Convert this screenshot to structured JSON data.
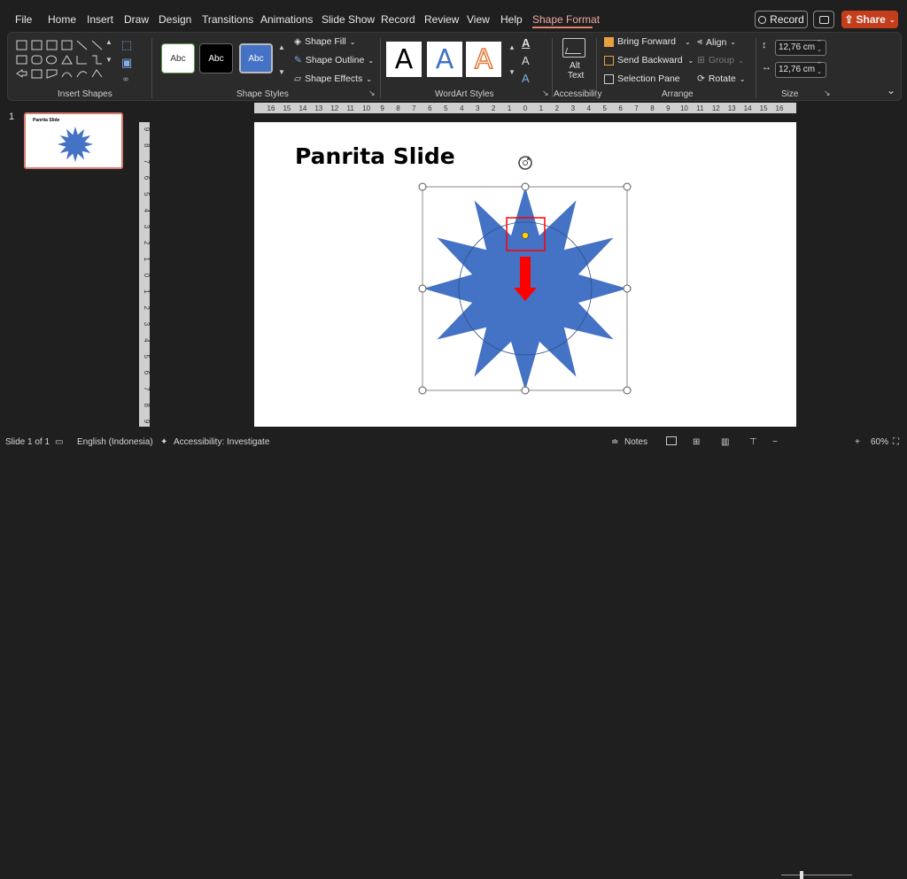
{
  "menu": {
    "tabs": [
      "File",
      "Home",
      "Insert",
      "Draw",
      "Design",
      "Transitions",
      "Animations",
      "Slide Show",
      "Record",
      "Review",
      "View",
      "Help",
      "Shape Format"
    ],
    "active_tab": "Shape Format",
    "record_label": "Record",
    "share_label": "Share"
  },
  "ribbon": {
    "insert_shapes_label": "Insert Shapes",
    "shape_styles": {
      "label": "Shape Styles",
      "presets": [
        "Abc",
        "Abc",
        "Abc"
      ],
      "fill": "Shape Fill",
      "outline": "Shape Outline",
      "effects": "Shape Effects"
    },
    "wordart": {
      "label": "WordArt Styles",
      "letters": [
        "A",
        "A",
        "A"
      ]
    },
    "accessibility": {
      "label": "Accessibility",
      "alt_text_line1": "Alt",
      "alt_text_line2": "Text"
    },
    "arrange": {
      "label": "Arrange",
      "bring_forward": "Bring Forward",
      "send_backward": "Send Backward",
      "selection_pane": "Selection Pane",
      "align": "Align",
      "group": "Group",
      "rotate": "Rotate"
    },
    "size": {
      "label": "Size",
      "height": "12,76 cm",
      "width": "12,76 cm"
    }
  },
  "ruler": {
    "horizontal": [
      "16",
      "15",
      "14",
      "13",
      "12",
      "11",
      "10",
      "9",
      "8",
      "7",
      "6",
      "5",
      "4",
      "3",
      "2",
      "1",
      "0",
      "1",
      "2",
      "3",
      "4",
      "5",
      "6",
      "7",
      "8",
      "9",
      "10",
      "11",
      "12",
      "13",
      "14",
      "15",
      "16"
    ],
    "vertical": [
      "9",
      "8",
      "7",
      "6",
      "5",
      "4",
      "3",
      "2",
      "1",
      "0",
      "1",
      "2",
      "3",
      "4",
      "5",
      "6",
      "7",
      "8",
      "9"
    ]
  },
  "thumbnail": {
    "number": "1",
    "title": "Panrita Slide"
  },
  "slide": {
    "title": "Panrita Slide"
  },
  "status": {
    "slide_of": "Slide 1 of 1",
    "language": "English (Indonesia)",
    "accessibility": "Accessibility: Investigate",
    "notes": "Notes",
    "zoom": "60%"
  },
  "colors": {
    "accent": "#e8836f",
    "star_fill": "#4472c4",
    "share": "#c43e1c",
    "annotation": "#ff0000",
    "handle_yellow": "#ffd700"
  }
}
